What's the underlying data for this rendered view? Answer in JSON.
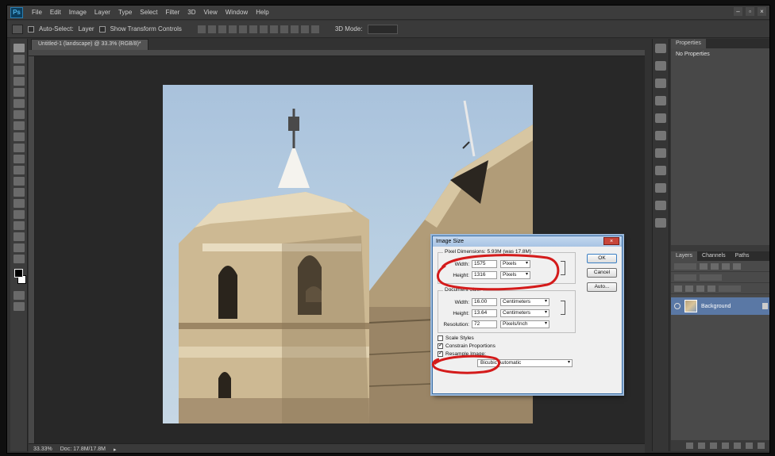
{
  "app": {
    "logo": "Ps",
    "menu": [
      "File",
      "Edit",
      "Image",
      "Layer",
      "Type",
      "Select",
      "Filter",
      "3D",
      "View",
      "Window",
      "Help"
    ],
    "window_controls": [
      "–",
      "▫",
      "×"
    ]
  },
  "options_bar": {
    "auto_select_label": "Auto-Select:",
    "auto_select_value": "Layer",
    "show_transform_label": "Show Transform Controls",
    "mode_label": "3D Mode:"
  },
  "document": {
    "tab_label": "Untitled-1 (landscape) @ 33.3% (RGB/8)*"
  },
  "status_bar": {
    "zoom": "33.33%",
    "doc_info": "Doc: 17.8M/17.8M"
  },
  "panels": {
    "properties_tab": "Properties",
    "properties_empty": "No Properties",
    "layers_tab": "Layers",
    "channels_tab": "Channels",
    "paths_tab": "Paths",
    "layer_name": "Background"
  },
  "dialog": {
    "title": "Image Size",
    "close_glyph": "×",
    "pixel_dimensions_label": "Pixel Dimensions: 5.93M (was 17.8M)",
    "px_width_label": "Width:",
    "px_width_value": "1575",
    "px_width_unit": "Pixels",
    "px_height_label": "Height:",
    "px_height_value": "1316",
    "px_height_unit": "Pixels",
    "document_size_label": "Document Size:",
    "doc_width_label": "Width:",
    "doc_width_value": "16.00",
    "doc_width_unit": "Centimeters",
    "doc_height_label": "Height:",
    "doc_height_value": "13.64",
    "doc_height_unit": "Centimeters",
    "resolution_label": "Resolution:",
    "resolution_value": "72",
    "resolution_unit": "Pixels/Inch",
    "scale_styles_label": "Scale Styles",
    "constrain_label": "Constrain Proportions",
    "resample_label": "Resample Image:",
    "resample_value": "Bicubic Automatic",
    "ok_label": "OK",
    "cancel_label": "Cancel",
    "auto_label": "Auto..."
  },
  "colors": {
    "annotation_red": "#d41b1b",
    "dialog_border": "#3a6ea5",
    "layer_selected": "#5a78a5"
  }
}
